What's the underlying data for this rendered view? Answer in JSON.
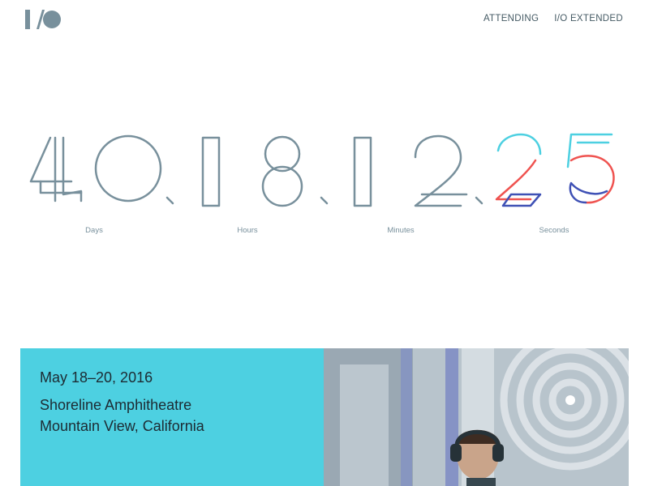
{
  "header": {
    "logo_alt": "I/O",
    "nav": [
      {
        "label": "ATTENDING"
      },
      {
        "label": "I/O EXTENDED"
      }
    ]
  },
  "countdown": {
    "units": [
      {
        "value": "40",
        "label": "Days"
      },
      {
        "value": "18",
        "label": "Hours"
      },
      {
        "value": "12",
        "label": "Minutes"
      },
      {
        "value": "25",
        "label": "Seconds"
      }
    ],
    "colors": {
      "digit_stroke": "#78909c",
      "accent_cyan": "#4dd0e1",
      "accent_red": "#ef5350",
      "accent_indigo": "#3f51b5"
    }
  },
  "event": {
    "date": "May 18–20, 2016",
    "venue": "Shoreline Amphitheatre",
    "city": "Mountain View, California",
    "panel_color": "#4dd0e1",
    "photo_icon": "attendee-with-headphones-photo"
  }
}
